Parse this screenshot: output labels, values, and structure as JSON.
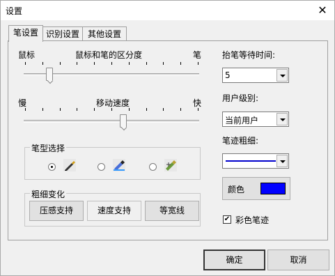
{
  "window": {
    "title": "设置",
    "close_glyph": "✕"
  },
  "tabs": [
    {
      "label": "笔设置",
      "active": true
    },
    {
      "label": "识别设置",
      "active": false
    },
    {
      "label": "其他设置",
      "active": false
    }
  ],
  "sensitivity": {
    "left_label": "鼠标",
    "center_label": "鼠标和笔的区分度",
    "right_label": "笔",
    "level": 0.14
  },
  "speed": {
    "left_label": "慢",
    "center_label": "移动速度",
    "right_label": "快",
    "level": 0.57
  },
  "pen_type": {
    "title": "笔型选择",
    "options": [
      {
        "icon": "pen-icon",
        "selected": true
      },
      {
        "icon": "highlighter-icon",
        "selected": false
      },
      {
        "icon": "brush-icon",
        "selected": false
      }
    ]
  },
  "thickness_change": {
    "title": "粗细变化",
    "buttons": [
      "压感支持",
      "速度支持",
      "等宽线"
    ]
  },
  "right": {
    "wait_time_label": "抬笔等待时间:",
    "wait_time_value": "5",
    "user_level_label": "用户级别:",
    "user_level_value": "当前用户",
    "stroke_width_label": "笔迹粗细:",
    "color_button_label": "颜色",
    "color_swatch": "#0000ff",
    "color_stroke_checkbox_label": "彩色笔迹",
    "color_stroke_checked": true
  },
  "footer": {
    "ok_label": "确定",
    "cancel_label": "取消"
  },
  "colors": {
    "accent": "#0000ff",
    "stroke_line": "#0000cc"
  }
}
